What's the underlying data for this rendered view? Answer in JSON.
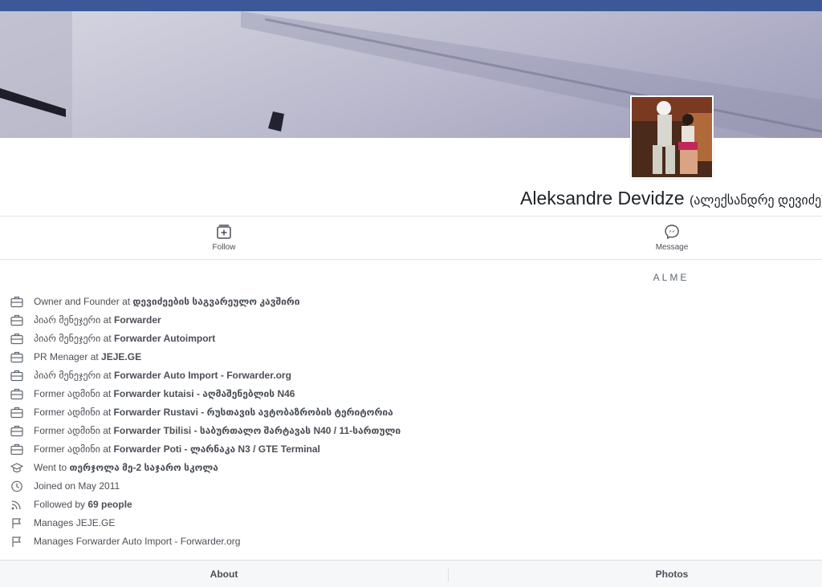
{
  "colors": {
    "brand": "#3b5998",
    "text": "#4b4f56",
    "name": "#1d2129"
  },
  "profile": {
    "name": "Aleksandre Devidze",
    "alt_name": "(ალექსანდრე დევიძე)"
  },
  "actions": {
    "follow": {
      "label": "Follow",
      "icon": "follow-icon"
    },
    "message": {
      "label": "Message",
      "icon": "messenger-icon"
    }
  },
  "company_label": "ALME",
  "info": [
    {
      "icon": "briefcase-icon",
      "pre": "Owner and Founder at ",
      "bold": "დევიძეების საგვარეულო კავშირი"
    },
    {
      "icon": "briefcase-icon",
      "pre": "პიარ მენეჯერი at ",
      "bold": "Forwarder"
    },
    {
      "icon": "briefcase-icon",
      "pre": "პიარ მენეჯერი at ",
      "bold": "Forwarder Autoimport"
    },
    {
      "icon": "briefcase-icon",
      "pre": "PR Menager at ",
      "bold": "JEJE.GE"
    },
    {
      "icon": "briefcase-icon",
      "pre": "პიარ მენეჯერი at ",
      "bold": "Forwarder Auto Import - Forwarder.org"
    },
    {
      "icon": "briefcase-icon",
      "pre": "Former ადმინი at ",
      "bold": "Forwarder kutaisi - აღმაშენებლის N46"
    },
    {
      "icon": "briefcase-icon",
      "pre": "Former ადმინი at ",
      "bold": "Forwarder Rustavi - რუსთავის ავტობაზრობის ტერიტორია"
    },
    {
      "icon": "briefcase-icon",
      "pre": "Former ადმინი at ",
      "bold": "Forwarder Tbilisi - საბურთალო შარტავას N40 / 11-სართული"
    },
    {
      "icon": "briefcase-icon",
      "pre": "Former ადმინი at ",
      "bold": "Forwarder Poti - ლარნაკა N3 / GTE Terminal"
    },
    {
      "icon": "graduation-cap-icon",
      "pre": "Went to ",
      "bold": "თერჯოლა მე-2 საჯარო სკოლა"
    },
    {
      "icon": "clock-icon",
      "pre": "Joined on May 2011",
      "bold": ""
    },
    {
      "icon": "rss-icon",
      "pre": "Followed by ",
      "bold": "69 people"
    },
    {
      "icon": "flag-icon",
      "pre": "Manages JEJE.GE",
      "bold": ""
    },
    {
      "icon": "flag-icon",
      "pre": "Manages Forwarder Auto Import - Forwarder.org",
      "bold": ""
    }
  ],
  "tabs": {
    "about": "About",
    "photos": "Photos"
  }
}
